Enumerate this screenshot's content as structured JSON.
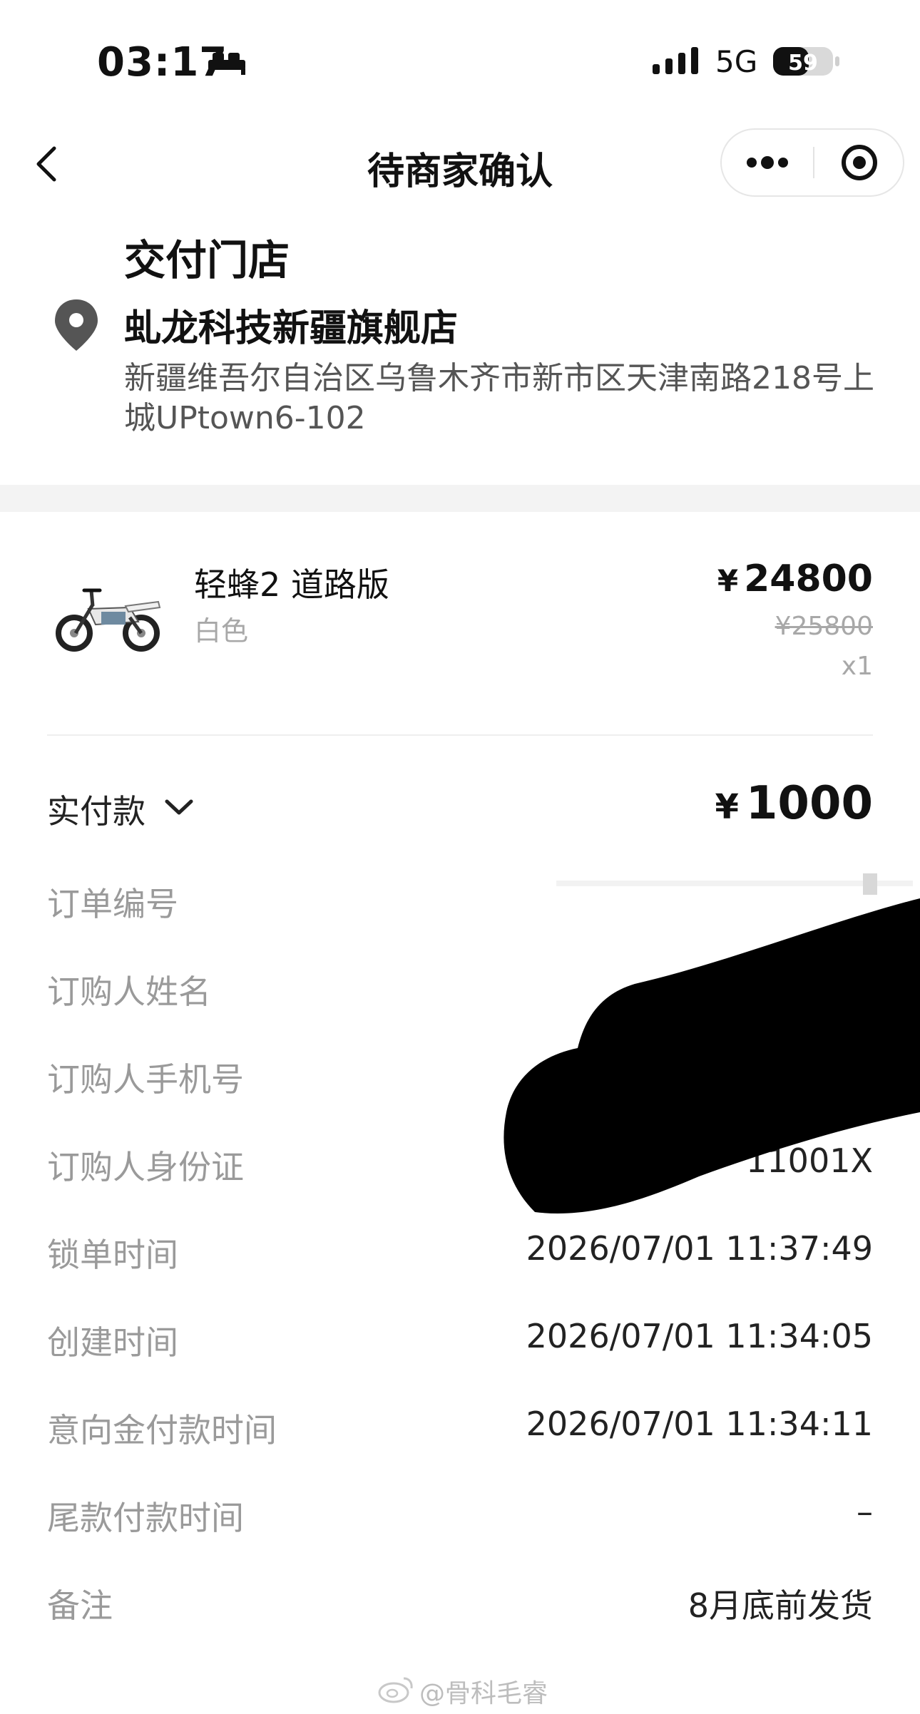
{
  "status_bar": {
    "time": "03:17",
    "network": "5G",
    "battery": "59",
    "icons": [
      "bed-icon",
      "signal-icon",
      "battery-icon"
    ]
  },
  "nav": {
    "title": "待商家确认",
    "back_icon": "chevron-left-icon",
    "more_icon": "more-dots-icon",
    "close_icon": "target-icon"
  },
  "store": {
    "heading": "交付门店",
    "name": "虬龙科技新疆旗舰店",
    "address": "新疆维吾尔自治区乌鲁木齐市新市区天津南路218号上城UPtown6-102"
  },
  "product": {
    "name": "轻蜂2 道路版",
    "color": "白色",
    "currency": "¥",
    "price": "24800",
    "original_price": "¥25800",
    "quantity": "x1"
  },
  "payment": {
    "label": "实付款",
    "currency": "¥",
    "amount": "1000"
  },
  "details": [
    {
      "label": "订单编号",
      "value": ""
    },
    {
      "label": "订购人姓名",
      "value": ""
    },
    {
      "label": "订购人手机号",
      "value": ""
    },
    {
      "label": "订购人身份证",
      "value": "11001X"
    },
    {
      "label": "锁单时间",
      "value": "2026/07/01 11:37:49"
    },
    {
      "label": "创建时间",
      "value": "2026/07/01 11:34:05"
    },
    {
      "label": "意向金付款时间",
      "value": "2026/07/01 11:34:11"
    },
    {
      "label": "尾款付款时间",
      "value": "–"
    },
    {
      "label": "备注",
      "value": "8月底前发货"
    }
  ],
  "watermark": {
    "text": "@骨科毛睿"
  },
  "colors": {
    "label_gray": "#9a9a9a",
    "text_dark": "#222222",
    "section_bg": "#f3f3f3"
  }
}
